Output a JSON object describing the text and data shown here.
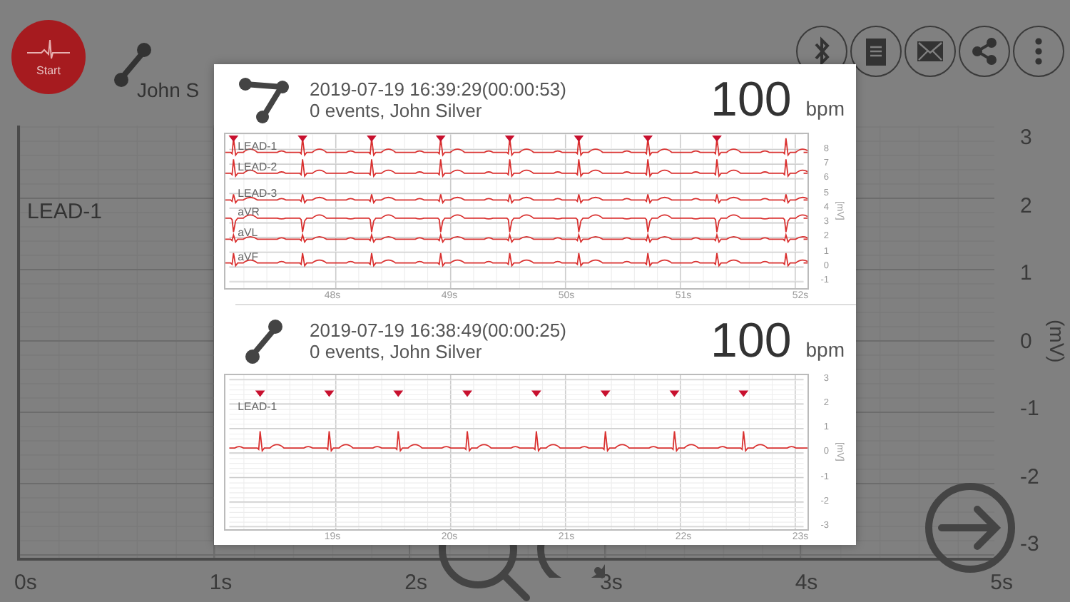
{
  "app": {
    "start_button": {
      "label": "Start"
    },
    "device": {
      "kind": "two-node"
    },
    "patient_name": "John S",
    "lead_label": "LEAD-1",
    "y_ticks": [
      "3",
      "2",
      "1",
      "0",
      "-1",
      "-2",
      "-3"
    ],
    "y_unit": "(mV)",
    "x_ticks": [
      "0s",
      "1s",
      "2s",
      "3s",
      "4s",
      "5s"
    ]
  },
  "dialog": {
    "recordings": [
      {
        "device": {
          "kind": "three-node"
        },
        "date": "2019-07-19 16:39:29(00:00:53)",
        "summary": "0 events, John Silver",
        "heart_rate": "100",
        "unit": "bpm",
        "leads": [
          {
            "name": "LEAD-1",
            "inverted": false
          },
          {
            "name": "LEAD-2",
            "inverted": false
          },
          {
            "name": "LEAD-3",
            "inverted": false
          },
          {
            "name": "aVR",
            "inverted": true
          },
          {
            "name": "aVL",
            "inverted": false
          },
          {
            "name": "aVF",
            "inverted": false
          }
        ],
        "y_ticks": [
          "8",
          "7",
          "6",
          "5",
          "4",
          "3",
          "2",
          "1",
          "0",
          "-1"
        ],
        "y_unit": "[mV]",
        "x_ticks": [
          "48s",
          "49s",
          "50s",
          "51s",
          "52s"
        ]
      },
      {
        "device": {
          "kind": "two-node"
        },
        "date": "2019-07-19 16:38:49(00:00:25)",
        "summary": "0 events, John Silver",
        "heart_rate": "100",
        "unit": "bpm",
        "leads": [
          {
            "name": "LEAD-1",
            "inverted": false
          }
        ],
        "y_ticks": [
          "3",
          "2",
          "1",
          "0",
          "-1",
          "-2",
          "-3"
        ],
        "y_unit": "[mV]",
        "x_ticks": [
          "19s",
          "20s",
          "21s",
          "22s",
          "23s"
        ]
      }
    ]
  }
}
